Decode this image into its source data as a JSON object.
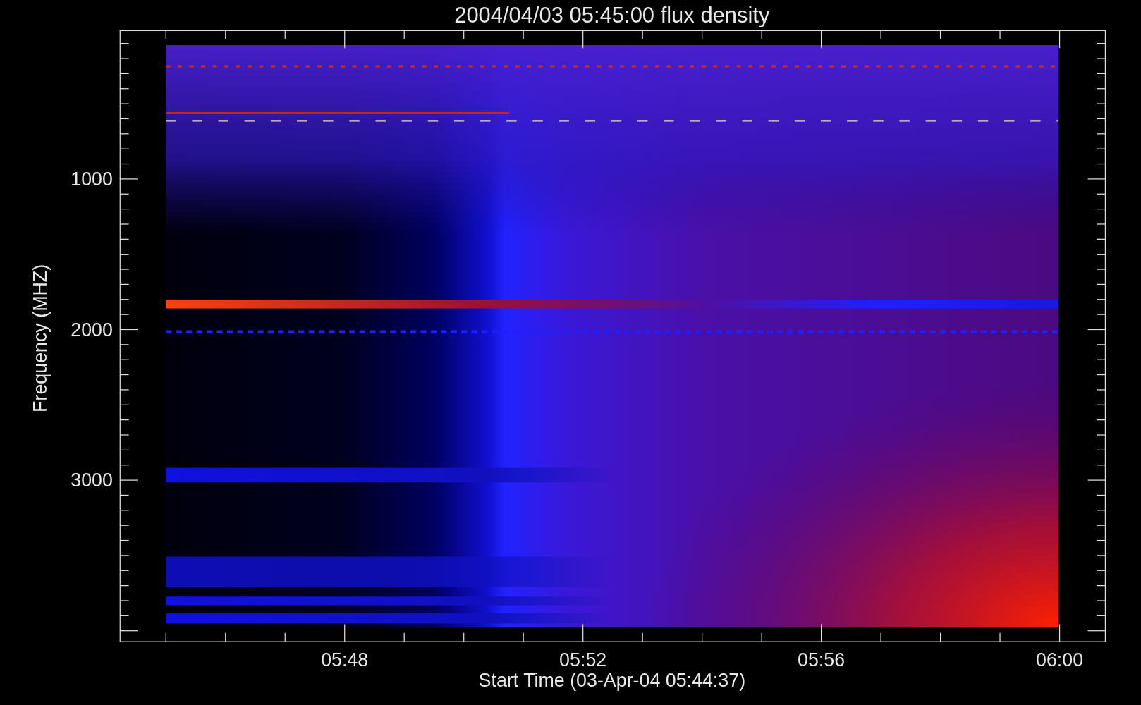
{
  "plot": {
    "title": "2004/04/03 05:45:00 flux density",
    "ylabel": "Frequency (MHZ)",
    "xlabel": "Start Time (03-Apr-04 05:44:37)",
    "yticks": [
      "1000",
      "2000",
      "3000"
    ],
    "xticks": [
      "05:48",
      "05:52",
      "05:56",
      "06:00"
    ]
  }
}
